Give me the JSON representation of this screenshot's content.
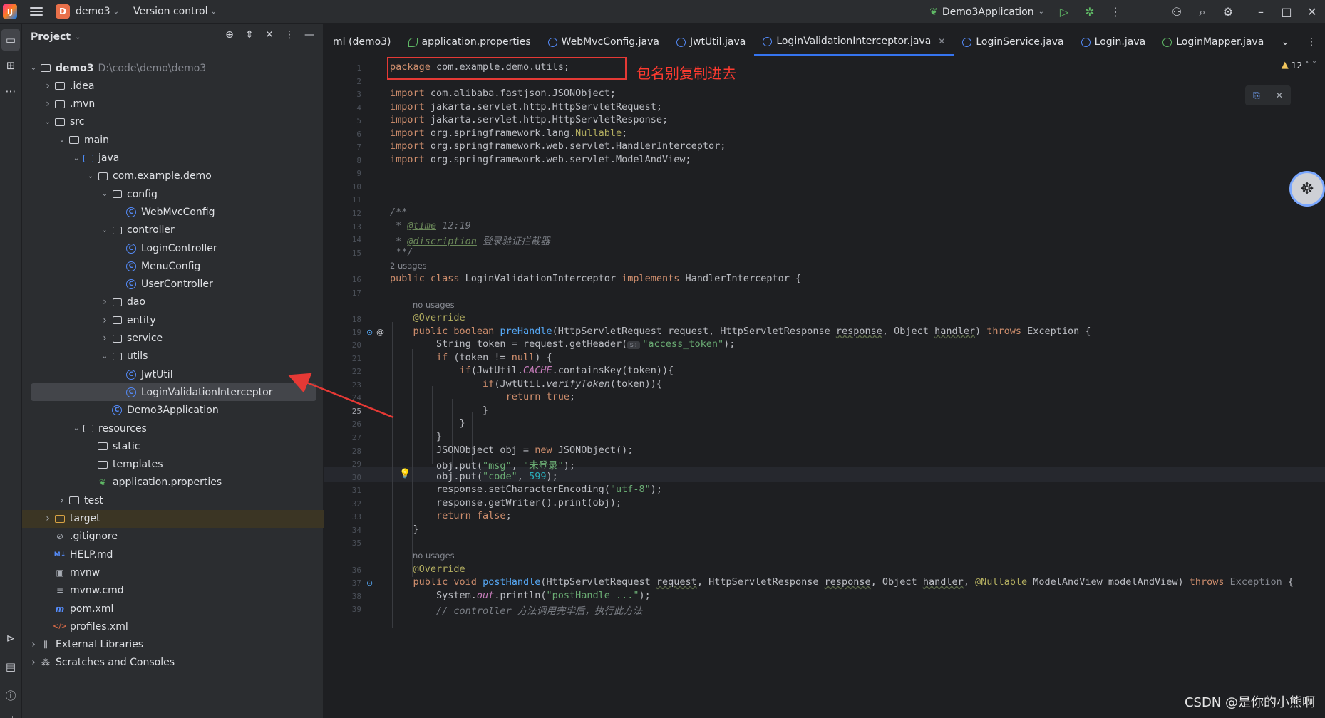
{
  "titlebar": {
    "project_badge": "D",
    "project_name": "demo3",
    "vcs": "Version control",
    "run_config": "Demo3Application"
  },
  "project_panel": {
    "title": "Project",
    "tree": [
      {
        "label": "demo3",
        "hint": "D:\\code\\demo\\demo3",
        "depth": 0,
        "icon": "module-folder",
        "expanded": true
      },
      {
        "label": ".idea",
        "depth": 1,
        "icon": "folder",
        "expanded": false
      },
      {
        "label": ".mvn",
        "depth": 1,
        "icon": "folder",
        "expanded": false
      },
      {
        "label": "src",
        "depth": 1,
        "icon": "folder",
        "expanded": true
      },
      {
        "label": "main",
        "depth": 2,
        "icon": "folder",
        "expanded": true
      },
      {
        "label": "java",
        "depth": 3,
        "icon": "source-folder",
        "expanded": true
      },
      {
        "label": "com.example.demo",
        "depth": 4,
        "icon": "package",
        "expanded": true
      },
      {
        "label": "config",
        "depth": 5,
        "icon": "package",
        "expanded": true
      },
      {
        "label": "WebMvcConfig",
        "depth": 6,
        "icon": "class"
      },
      {
        "label": "controller",
        "depth": 5,
        "icon": "package",
        "expanded": true
      },
      {
        "label": "LoginController",
        "depth": 6,
        "icon": "class"
      },
      {
        "label": "MenuConfig",
        "depth": 6,
        "icon": "class"
      },
      {
        "label": "UserController",
        "depth": 6,
        "icon": "class"
      },
      {
        "label": "dao",
        "depth": 5,
        "icon": "package",
        "expanded": false
      },
      {
        "label": "entity",
        "depth": 5,
        "icon": "package",
        "expanded": false
      },
      {
        "label": "service",
        "depth": 5,
        "icon": "package",
        "expanded": false
      },
      {
        "label": "utils",
        "depth": 5,
        "icon": "package",
        "expanded": true
      },
      {
        "label": "JwtUtil",
        "depth": 6,
        "icon": "class"
      },
      {
        "label": "LoginValidationInterceptor",
        "depth": 6,
        "icon": "class",
        "selected": true
      },
      {
        "label": "Demo3Application",
        "depth": 5,
        "icon": "class"
      },
      {
        "label": "resources",
        "depth": 3,
        "icon": "resources-folder",
        "expanded": true
      },
      {
        "label": "static",
        "depth": 4,
        "icon": "folder"
      },
      {
        "label": "templates",
        "depth": 4,
        "icon": "folder"
      },
      {
        "label": "application.properties",
        "depth": 4,
        "icon": "properties"
      },
      {
        "label": "test",
        "depth": 2,
        "icon": "folder",
        "expanded": false
      },
      {
        "label": "target",
        "depth": 1,
        "icon": "excluded-folder",
        "expanded": false,
        "highlight": true
      },
      {
        "label": ".gitignore",
        "depth": 1,
        "icon": "ignore"
      },
      {
        "label": "HELP.md",
        "depth": 1,
        "icon": "markdown"
      },
      {
        "label": "mvnw",
        "depth": 1,
        "icon": "script"
      },
      {
        "label": "mvnw.cmd",
        "depth": 1,
        "icon": "text"
      },
      {
        "label": "pom.xml",
        "depth": 1,
        "icon": "maven"
      },
      {
        "label": "profiles.xml",
        "depth": 1,
        "icon": "xml"
      },
      {
        "label": "External Libraries",
        "depth": 0,
        "icon": "libraries",
        "expanded": false
      },
      {
        "label": "Scratches and Consoles",
        "depth": 0,
        "icon": "scratches",
        "expanded": false
      }
    ]
  },
  "tabs": [
    {
      "label": "ml (demo3)",
      "icon": "none"
    },
    {
      "label": "application.properties",
      "icon": "leaf"
    },
    {
      "label": "WebMvcConfig.java",
      "icon": "class"
    },
    {
      "label": "JwtUtil.java",
      "icon": "class"
    },
    {
      "label": "LoginValidationInterceptor.java",
      "icon": "class",
      "active": true
    },
    {
      "label": "LoginService.java",
      "icon": "class"
    },
    {
      "label": "Login.java",
      "icon": "class"
    },
    {
      "label": "LoginMapper.java",
      "icon": "interface"
    }
  ],
  "editor": {
    "warnings": "12",
    "annotation_text": "包名别复制进去",
    "current_line": 25,
    "line_numbers": [
      "1",
      "2",
      "3",
      "4",
      "5",
      "6",
      "7",
      "8",
      "9",
      "10",
      "11",
      "12",
      "13",
      "14",
      "15",
      "16",
      "17",
      "18",
      "19",
      "20",
      "21",
      "22",
      "23",
      "24",
      "25",
      "26",
      "27",
      "28",
      "29",
      "30",
      "31",
      "32",
      "33",
      "34",
      "35",
      "36",
      "37",
      "38",
      "39"
    ],
    "hints": {
      "usages_2": "2 usages",
      "no_usages_1": "no usages",
      "no_usages_2": "no usages",
      "param_s": "s:"
    }
  },
  "watermark": "CSDN @是你的小熊啊"
}
